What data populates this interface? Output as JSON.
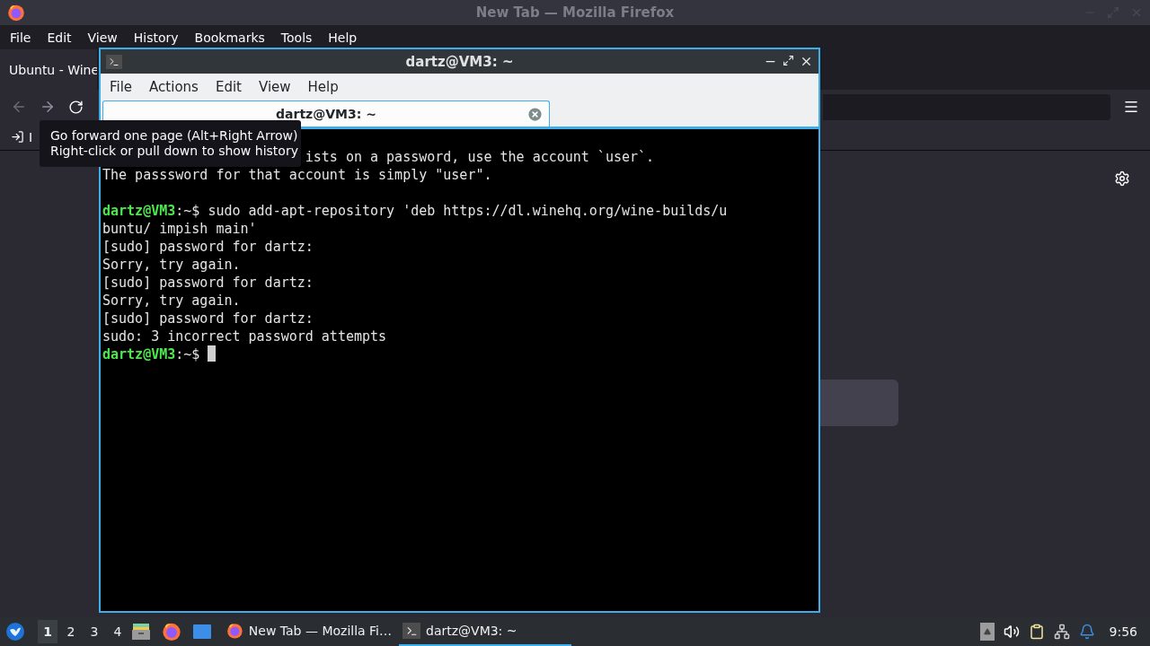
{
  "firefox": {
    "title": "New Tab — Mozilla Firefox",
    "menu": [
      "File",
      "Edit",
      "View",
      "History",
      "Bookmarks",
      "Tools",
      "Help"
    ],
    "tabs": [
      {
        "label": "Ubuntu - Wine",
        "selected": true
      }
    ],
    "bookmarks": [
      {
        "label": "I"
      }
    ],
    "tooltip": [
      "Go forward one page (Alt+Right Arrow)",
      "Right-click or pull down to show history"
    ]
  },
  "terminal": {
    "title": "dartz@VM3: ~",
    "menu": [
      "File",
      "Actions",
      "Edit",
      "View",
      "Help"
    ],
    "tabs": [
      {
        "label": "dartz@VM3: ~",
        "selected": true
      }
    ],
    "lines": [
      {
        "kind": "clipped",
        "text": "ists on a password, use the account `user`."
      },
      {
        "kind": "output",
        "text": "The passsword for that account is simply \"user\"."
      },
      {
        "kind": "blank"
      },
      {
        "kind": "prompt",
        "user": "dartz@VM3",
        "text": ":~$ sudo add-apt-repository 'deb https://dl.winehq.org/wine-builds/u"
      },
      {
        "kind": "output",
        "text": "buntu/ impish main'"
      },
      {
        "kind": "output",
        "text": "[sudo] password for dartz:"
      },
      {
        "kind": "output",
        "text": "Sorry, try again."
      },
      {
        "kind": "output",
        "text": "[sudo] password for dartz:"
      },
      {
        "kind": "output",
        "text": "Sorry, try again."
      },
      {
        "kind": "output",
        "text": "[sudo] password for dartz:"
      },
      {
        "kind": "output",
        "text": "sudo: 3 incorrect password attempts"
      },
      {
        "kind": "prompt",
        "user": "dartz@VM3",
        "text": ":~$ ",
        "cursor": true
      }
    ]
  },
  "taskbar": {
    "workspaces": [
      {
        "label": "1",
        "selected": true
      },
      {
        "label": "2",
        "selected": false
      },
      {
        "label": "3",
        "selected": false
      },
      {
        "label": "4",
        "selected": false
      }
    ],
    "tasks": [
      {
        "kind": "firefox",
        "label": "New Tab — Mozilla Fi…",
        "selected": false
      },
      {
        "kind": "terminal",
        "label": "dartz@VM3: ~",
        "selected": true
      }
    ],
    "clock": "9:56"
  }
}
